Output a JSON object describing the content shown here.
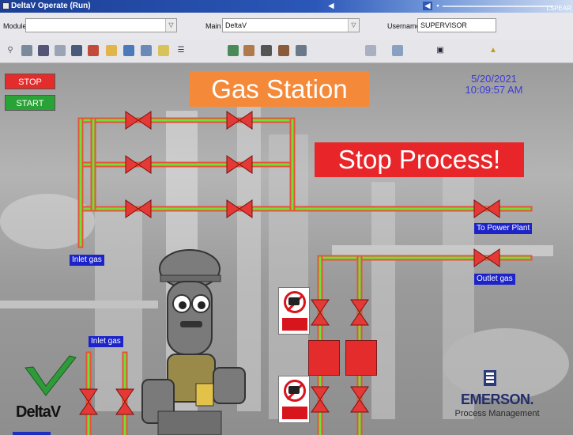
{
  "window": {
    "title": "DeltaV Operate (Run)",
    "user_label": "LSPEAR"
  },
  "fields": {
    "module_label": "Module",
    "module_value": "",
    "main_label": "Main",
    "main_value": "DeltaV",
    "username_label": "Username",
    "username_value": "SUPERVISOR"
  },
  "toolbar_icons": [
    "wrench-icon",
    "printer-icon",
    "cabinet-icon",
    "document-icon",
    "tram-icon",
    "binder-icon",
    "folder-icon",
    "flask-icon",
    "file-icon",
    "notes-icon",
    "list-icon",
    "station-icon",
    "person-icon",
    "workstation-icon",
    "tools-icon",
    "lock-icon",
    "diagnostic-icon",
    "operator-icon",
    "alarm-icon"
  ],
  "controls": {
    "stop_label": "STOP",
    "start_label": "START"
  },
  "display": {
    "title": "Gas Station",
    "banner": "Stop Process!",
    "date": "5/20/2021",
    "time": "10:09:57 AM"
  },
  "tags": {
    "inlet_gas_1": "Inlet gas",
    "inlet_gas_2": "Inlet gas",
    "to_power_plant": "To Power Plant",
    "outlet_gas": "Outlet gas"
  },
  "branding": {
    "deltav": "DeltaV",
    "emerson": "EMERSON.",
    "emerson_sub": "Process Management"
  },
  "colors": {
    "pipe_green": "#6fe03a",
    "pipe_red": "#e8523a",
    "valve_red": "#e53935",
    "tag_blue": "#1c24c9",
    "clock_blue": "#3b3bd8"
  }
}
